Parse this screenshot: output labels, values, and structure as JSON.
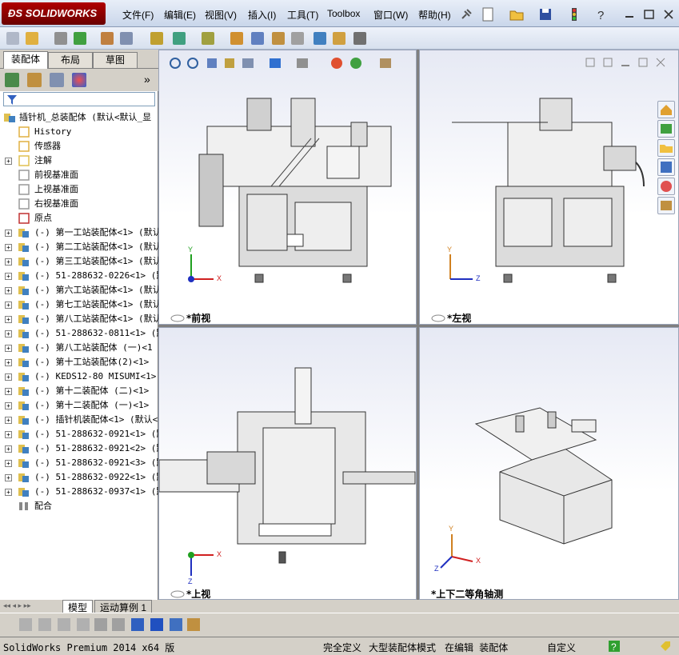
{
  "app": {
    "logo_text": "SOLIDWORKS"
  },
  "menu": [
    {
      "label": "文件(F)"
    },
    {
      "label": "编辑(E)"
    },
    {
      "label": "视图(V)"
    },
    {
      "label": "插入(I)"
    },
    {
      "label": "工具(T)"
    },
    {
      "label": "Toolbox"
    },
    {
      "label": "窗口(W)"
    },
    {
      "label": "帮助(H)"
    }
  ],
  "panel": {
    "tabs": [
      {
        "label": "装配体"
      },
      {
        "label": "布局"
      },
      {
        "label": "草图"
      }
    ],
    "collapse_glyph": "»"
  },
  "tree": {
    "root": "插针机_总装配体 (默认<默认_显",
    "items": [
      {
        "label": "History",
        "expander": ""
      },
      {
        "label": "传感器",
        "expander": ""
      },
      {
        "label": "注解",
        "expander": "+"
      },
      {
        "label": "前视基准面",
        "expander": ""
      },
      {
        "label": "上视基准面",
        "expander": ""
      },
      {
        "label": "右视基准面",
        "expander": ""
      },
      {
        "label": "原点",
        "expander": ""
      },
      {
        "label": "(-) 第一工站装配体<1> (默认",
        "expander": "+"
      },
      {
        "label": "(-) 第二工站装配体<1> (默认",
        "expander": "+"
      },
      {
        "label": "(-) 第三工站装配体<1> (默认",
        "expander": "+"
      },
      {
        "label": "(-) 51-288632-0226<1> (默",
        "expander": "+"
      },
      {
        "label": "(-) 第六工站装配体<1> (默认",
        "expander": "+"
      },
      {
        "label": "(-) 第七工站装配体<1> (默认",
        "expander": "+"
      },
      {
        "label": "(-) 第八工站装配体<1> (默认",
        "expander": "+"
      },
      {
        "label": "(-) 51-288632-0811<1> (默",
        "expander": "+"
      },
      {
        "label": "(-) 第八工站装配体 (一)<1",
        "expander": "+"
      },
      {
        "label": "(-) 第十工站装配体(2)<1>",
        "expander": "+"
      },
      {
        "label": "(-) KEDS12-80 MISUMI<1> (",
        "expander": "+"
      },
      {
        "label": "(-) 第十二装配体 (二)<1>",
        "expander": "+"
      },
      {
        "label": "(-) 第十二装配体 (一)<1>",
        "expander": "+"
      },
      {
        "label": "(-) 插针机装配体<1> (默认<",
        "expander": "+"
      },
      {
        "label": "(-) 51-288632-0921<1> (默",
        "expander": "+"
      },
      {
        "label": "(-) 51-288632-0921<2> (默",
        "expander": "+"
      },
      {
        "label": "(-) 51-288632-0921<3> (默",
        "expander": "+"
      },
      {
        "label": "(-) 51-288632-0922<1> (默",
        "expander": "+"
      },
      {
        "label": "(-) 51-288632-0937<1> (默",
        "expander": "+"
      },
      {
        "label": "配合",
        "expander": ""
      }
    ]
  },
  "viewports": {
    "front": "*前视",
    "left": "*左视",
    "top": "*上视",
    "iso": "*上下二等角轴测"
  },
  "axes": {
    "x": "X",
    "y": "Y",
    "z": "Z"
  },
  "bottom_tabs": {
    "model": "模型",
    "motion": "运动算例 1"
  },
  "status": {
    "version": "SolidWorks Premium 2014 x64 版",
    "define": "完全定义",
    "mode": "大型装配体模式",
    "editing": "在编辑 装配体",
    "custom": "自定义"
  },
  "colors": {
    "accent": "#b00000",
    "axis_x": "#d02020",
    "axis_y": "#20a020",
    "axis_z": "#2030c0"
  }
}
